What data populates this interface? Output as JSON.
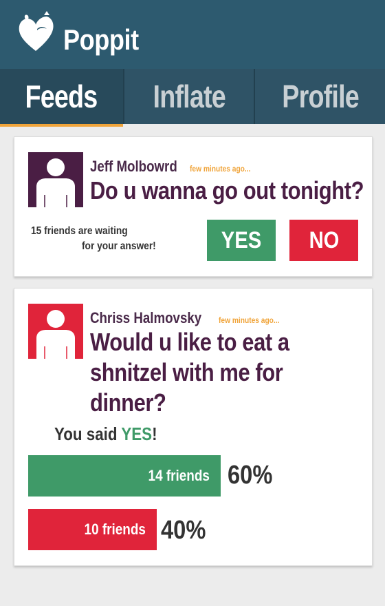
{
  "app": {
    "title": "Poppit",
    "logo_icon": "heart-balloon-icon",
    "header_color": "#2d5a6f"
  },
  "tabs": [
    {
      "label": "Feeds",
      "active": true
    },
    {
      "label": "Inflate",
      "active": false
    },
    {
      "label": "Profile",
      "active": false
    }
  ],
  "colors": {
    "yes": "#3f9a68",
    "no": "#e0243a",
    "accent": "#f0a43a",
    "question": "#4a1e44"
  },
  "feed": [
    {
      "author": "Jeff Molbowrd",
      "time": "few minutes ago...",
      "avatar_color": "#4a1e44",
      "question": "Do u wanna go out tonight?",
      "waiting_line1": "15 friends are waiting",
      "waiting_line2": "for your answer!",
      "yes_label": "YES",
      "no_label": "NO"
    },
    {
      "author": "Chriss Halmovsky",
      "time": "few minutes ago...",
      "avatar_color": "#e0243a",
      "question": "Would u like to eat a shnitzel with me for dinner?",
      "you_said_prefix": "You said ",
      "you_said_answer": "YES",
      "you_said_suffix": "!",
      "results": {
        "yes_label": "14 friends",
        "yes_percent_text": "60%",
        "yes_fraction": 0.6,
        "no_label": "10 friends",
        "no_percent_text": "40%",
        "no_fraction": 0.4
      }
    }
  ]
}
